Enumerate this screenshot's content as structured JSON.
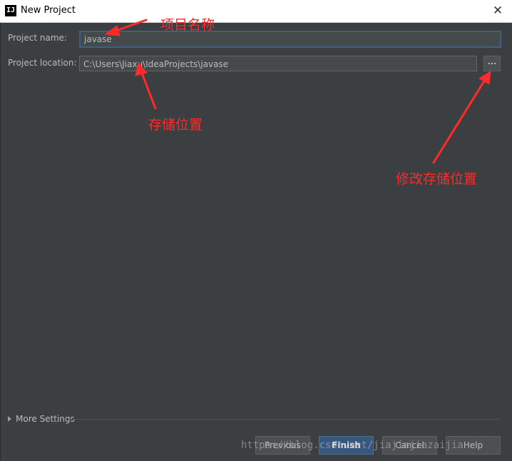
{
  "window": {
    "title": "New Project",
    "app_icon_text": "IJ",
    "close_glyph": "✕"
  },
  "form": {
    "name_label": "Project name:",
    "name_value": "javase",
    "location_label": "Project location:",
    "location_value": "C:\\Users\\Jiaxu\\IdeaProjects\\javase",
    "browse_label": "..."
  },
  "annotations": {
    "project_name": "项目名称",
    "storage_location": "存储位置",
    "change_location": "修改存储位置"
  },
  "more_settings": {
    "label": "More Settings"
  },
  "buttons": {
    "previous": "Previous",
    "finish": "Finish",
    "cancel": "Cancel",
    "help": "Help"
  },
  "watermark": "https://blog.csdn.net/jiajiajiazaijia",
  "colors": {
    "background": "#3c3f41",
    "annotation": "#ff2a2a",
    "focus_border": "#3d6185",
    "primary_button": "#365880"
  }
}
